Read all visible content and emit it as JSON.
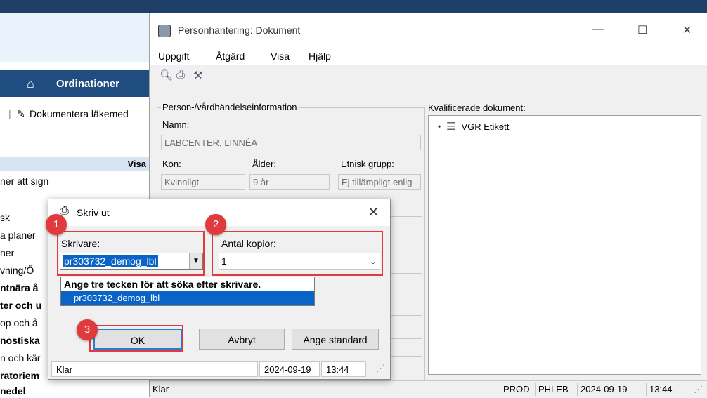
{
  "background": {
    "nav_label": "Ordinationer",
    "dokumentera": "Dokumentera läkemed",
    "visa": "Visa",
    "list_items": [
      "ner att signera",
      "sk",
      "a planer",
      "ner",
      "vning/Ö",
      "ntnära å",
      "ter och u",
      "op och å",
      "nostiska",
      "n och kär",
      "ratoriem",
      "nedel"
    ]
  },
  "main_window": {
    "title": "Personhantering: Dokument",
    "menu": [
      "Uppgift",
      "Åtgärd",
      "Visa",
      "Hjälp"
    ],
    "person_group_title": "Person-/vårdhändelseinformation",
    "name_label": "Namn:",
    "name_value": "LABCENTER, LINNÉA",
    "gender_label": "Kön:",
    "gender_value": "Kvinnligt",
    "age_label": "Ålder:",
    "age_value": "9 år",
    "ethnic_label": "Etnisk grupp:",
    "ethnic_value": "Ej tillämpligt enlig",
    "qualified_title": "Kvalificerade dokument:",
    "qualified_item": "VGR Etikett",
    "status": {
      "text": "Klar",
      "env": "PROD",
      "role": "PHLEB",
      "date": "2024-09-19",
      "time": "13:44"
    }
  },
  "dialog": {
    "title": "Skriv ut",
    "printer_label": "Skrivare:",
    "printer_value": "pr303732_demog_lbl",
    "copies_label": "Antal kopior:",
    "copies_value": "1",
    "dropdown_hint": "Ange tre tecken för att söka efter skrivare.",
    "dropdown_option": "pr303732_demog_lbl",
    "ok_label": "OK",
    "cancel_label": "Avbryt",
    "default_label": "Ange standard",
    "status": {
      "text": "Klar",
      "date": "2024-09-19",
      "time": "13:44"
    }
  },
  "annotations": [
    "1",
    "2",
    "3"
  ],
  "colors": {
    "annotation": "#e0393e",
    "selection": "#0a64c8",
    "nav": "#1f4d7f"
  }
}
